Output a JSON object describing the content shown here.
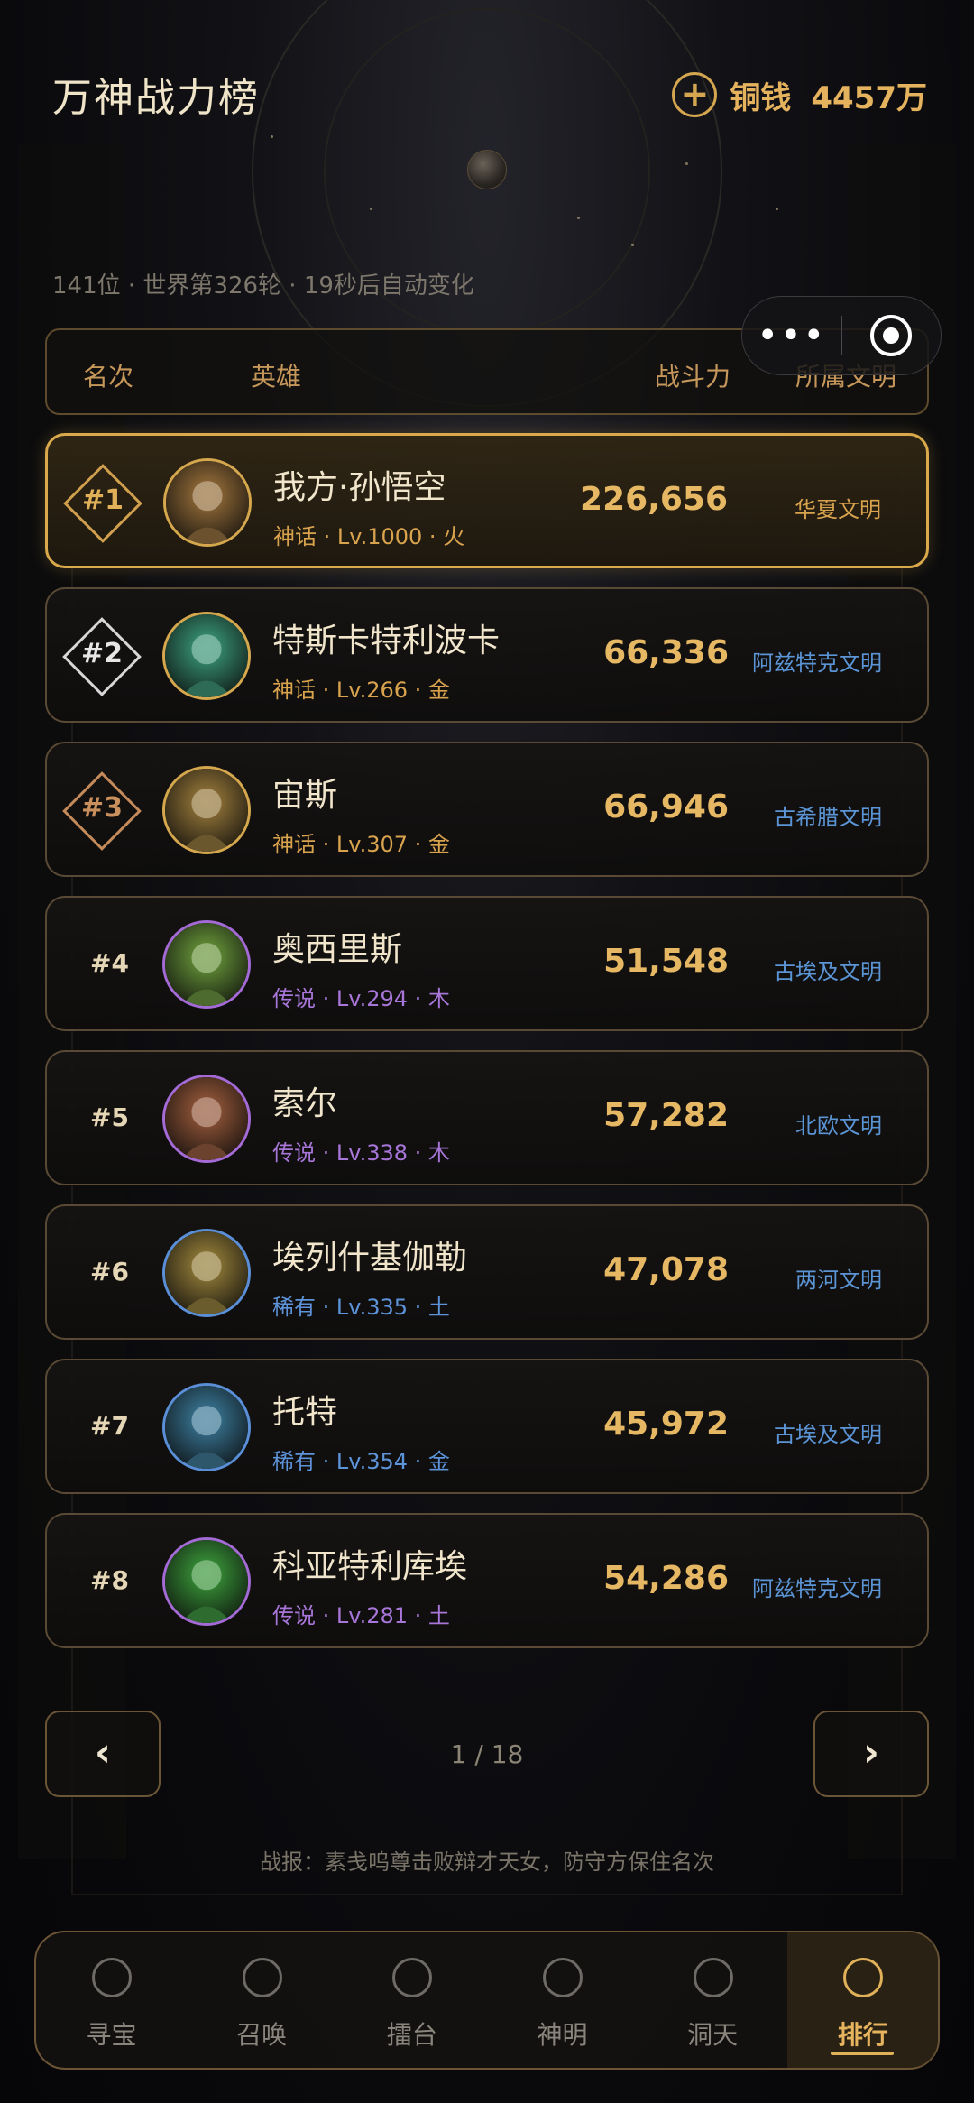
{
  "header": {
    "title": "万神战力榜",
    "currency_label": "铜钱",
    "currency_value": "4457万"
  },
  "status_line": "141位 · 世界第326轮 · 19秒后自动变化",
  "capsule": {
    "more_icon": "more-dots-icon",
    "close_icon": "target-close-icon",
    "more_text": "•••"
  },
  "table_header": {
    "rank": "名次",
    "hero": "英雄",
    "power": "战斗力",
    "civ": "所属文明"
  },
  "rows": [
    {
      "rank": "#1",
      "name": "我方·孙悟空",
      "meta": "神话 · Lv.1000 · 火",
      "power": "226,656",
      "civ": "华夏文明",
      "tier": "mythic",
      "rank_style": "gold"
    },
    {
      "rank": "#2",
      "name": "特斯卡特利波卡",
      "meta": "神话 · Lv.266 · 金",
      "power": "66,336",
      "civ": "阿兹特克文明",
      "tier": "mythic",
      "rank_style": "silver"
    },
    {
      "rank": "#3",
      "name": "宙斯",
      "meta": "神话 · Lv.307 · 金",
      "power": "66,946",
      "civ": "古希腊文明",
      "tier": "mythic",
      "rank_style": "bronze"
    },
    {
      "rank": "#4",
      "name": "奥西里斯",
      "meta": "传说 · Lv.294 · 木",
      "power": "51,548",
      "civ": "古埃及文明",
      "tier": "legend",
      "rank_style": "plain"
    },
    {
      "rank": "#5",
      "name": "索尔",
      "meta": "传说 · Lv.338 · 木",
      "power": "57,282",
      "civ": "北欧文明",
      "tier": "legend",
      "rank_style": "plain"
    },
    {
      "rank": "#6",
      "name": "埃列什基伽勒",
      "meta": "稀有 · Lv.335 · 土",
      "power": "47,078",
      "civ": "两河文明",
      "tier": "rare",
      "rank_style": "plain"
    },
    {
      "rank": "#7",
      "name": "托特",
      "meta": "稀有 · Lv.354 · 金",
      "power": "45,972",
      "civ": "古埃及文明",
      "tier": "rare",
      "rank_style": "plain"
    },
    {
      "rank": "#8",
      "name": "科亚特利库埃",
      "meta": "传说 · Lv.281 · 土",
      "power": "54,286",
      "civ": "阿兹特克文明",
      "tier": "legend",
      "rank_style": "plain"
    }
  ],
  "pager": {
    "prev": "‹",
    "next": "›",
    "text": "1 / 18"
  },
  "battle_report": "战报：素戋呜尊击败辩才天女，防守方保住名次",
  "nav": [
    {
      "label": "寻宝",
      "icon": "treasure-icon"
    },
    {
      "label": "召唤",
      "icon": "summon-icon"
    },
    {
      "label": "擂台",
      "icon": "arena-icon"
    },
    {
      "label": "神明",
      "icon": "deity-icon"
    },
    {
      "label": "洞天",
      "icon": "cave-icon"
    },
    {
      "label": "排行",
      "icon": "ranking-icon",
      "active": true
    }
  ],
  "colors": {
    "accent": "#e1b15a",
    "mythic": "#d9a34e",
    "legend": "#a776d8",
    "rare": "#5d93d9"
  }
}
